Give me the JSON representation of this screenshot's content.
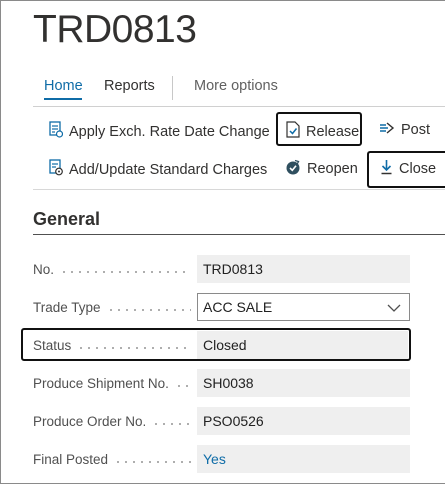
{
  "page": {
    "title": "TRD0813"
  },
  "tabs": [
    {
      "label": "Home",
      "active": true
    },
    {
      "label": "Reports",
      "active": false
    },
    {
      "label": "More options",
      "active": false
    }
  ],
  "actions": {
    "apply_exch_rate": {
      "label": "Apply Exch. Rate Date Change",
      "icon": "document-edit-icon"
    },
    "release": {
      "label": "Release",
      "icon": "release-document-icon",
      "highlighted": true
    },
    "post": {
      "label": "Post",
      "icon": "post-icon"
    },
    "add_update_charges": {
      "label": "Add/Update Standard Charges",
      "icon": "document-gear-icon"
    },
    "reopen": {
      "label": "Reopen",
      "icon": "reopen-icon"
    },
    "close": {
      "label": "Close",
      "icon": "download-arrow-icon",
      "highlighted": true
    }
  },
  "section": {
    "title": "General"
  },
  "fields": {
    "no": {
      "label": "No.",
      "value": "TRD0813"
    },
    "trade_type": {
      "label": "Trade Type",
      "value": "ACC SALE"
    },
    "status": {
      "label": "Status",
      "value": "Closed",
      "highlighted": true
    },
    "produce_shipment_no": {
      "label": "Produce Shipment No.",
      "value": "SH0038"
    },
    "produce_order_no": {
      "label": "Produce Order No.",
      "value": "PSO0526"
    },
    "final_posted": {
      "label": "Final Posted",
      "value": "Yes"
    }
  },
  "colors": {
    "accent": "#0f6ca7",
    "field_bg": "#efefef",
    "text": "#323130"
  }
}
